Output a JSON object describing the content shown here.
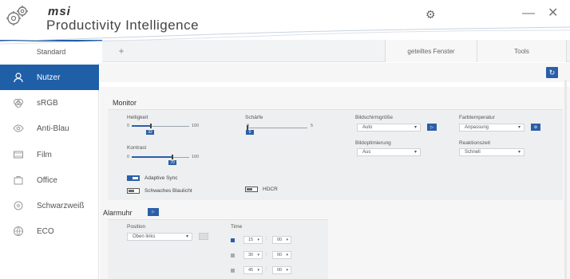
{
  "titlebar": {
    "brand": "msi",
    "app_name": "Productivity Intelligence",
    "minimize": "—",
    "close": "✕"
  },
  "tabs": {
    "standard": "Standard",
    "plus": "+",
    "split_window": "geteiltes Fenster",
    "tools": "Tools"
  },
  "sidebar": {
    "items": [
      {
        "label": "Nutzer",
        "icon": "user-icon",
        "active": true
      },
      {
        "label": "sRGB",
        "icon": "srgb-icon"
      },
      {
        "label": "Anti-Blau",
        "icon": "eye-icon"
      },
      {
        "label": "Film",
        "icon": "film-icon"
      },
      {
        "label": "Office",
        "icon": "office-icon"
      },
      {
        "label": "Schwarzweiß",
        "icon": "grayscale-icon"
      },
      {
        "label": "ECO",
        "icon": "eco-icon"
      }
    ]
  },
  "monitor": {
    "title": "Monitor",
    "brightness": {
      "label": "Helligkeit",
      "min": "0",
      "max": "100",
      "value": "32"
    },
    "contrast": {
      "label": "Kontrast",
      "min": "0",
      "max": "100",
      "value": "70"
    },
    "sharpness": {
      "label": "Schärfe",
      "min": "0",
      "max": "5",
      "value": "0"
    },
    "adaptive_sync": "Adaptive Sync",
    "low_blue_light": "Schwaches Blaulicht",
    "hdcr": "HDCR",
    "screen_size": {
      "label": "Bildschirmgröße",
      "value": "Auto"
    },
    "image_optimization": {
      "label": "Bildoptimierung",
      "value": "Aus"
    },
    "color_temperature": {
      "label": "Farbtemperatur",
      "value": "Anpassung"
    },
    "response_time": {
      "label": "Reaktionszeit",
      "value": "Schnell"
    }
  },
  "alarm": {
    "title": "Alarmuhr",
    "position_label": "Position",
    "position_value": "Oben links",
    "time_label": "Time",
    "rows": [
      {
        "minutes": "15",
        "seconds": "00",
        "enabled": true
      },
      {
        "minutes": "30",
        "seconds": "00",
        "enabled": false
      },
      {
        "minutes": "45",
        "seconds": "00",
        "enabled": false
      }
    ],
    "colon": ":"
  },
  "colors": {
    "accent": "#2a5fa8",
    "sidebar_active": "#1f5fa8"
  }
}
